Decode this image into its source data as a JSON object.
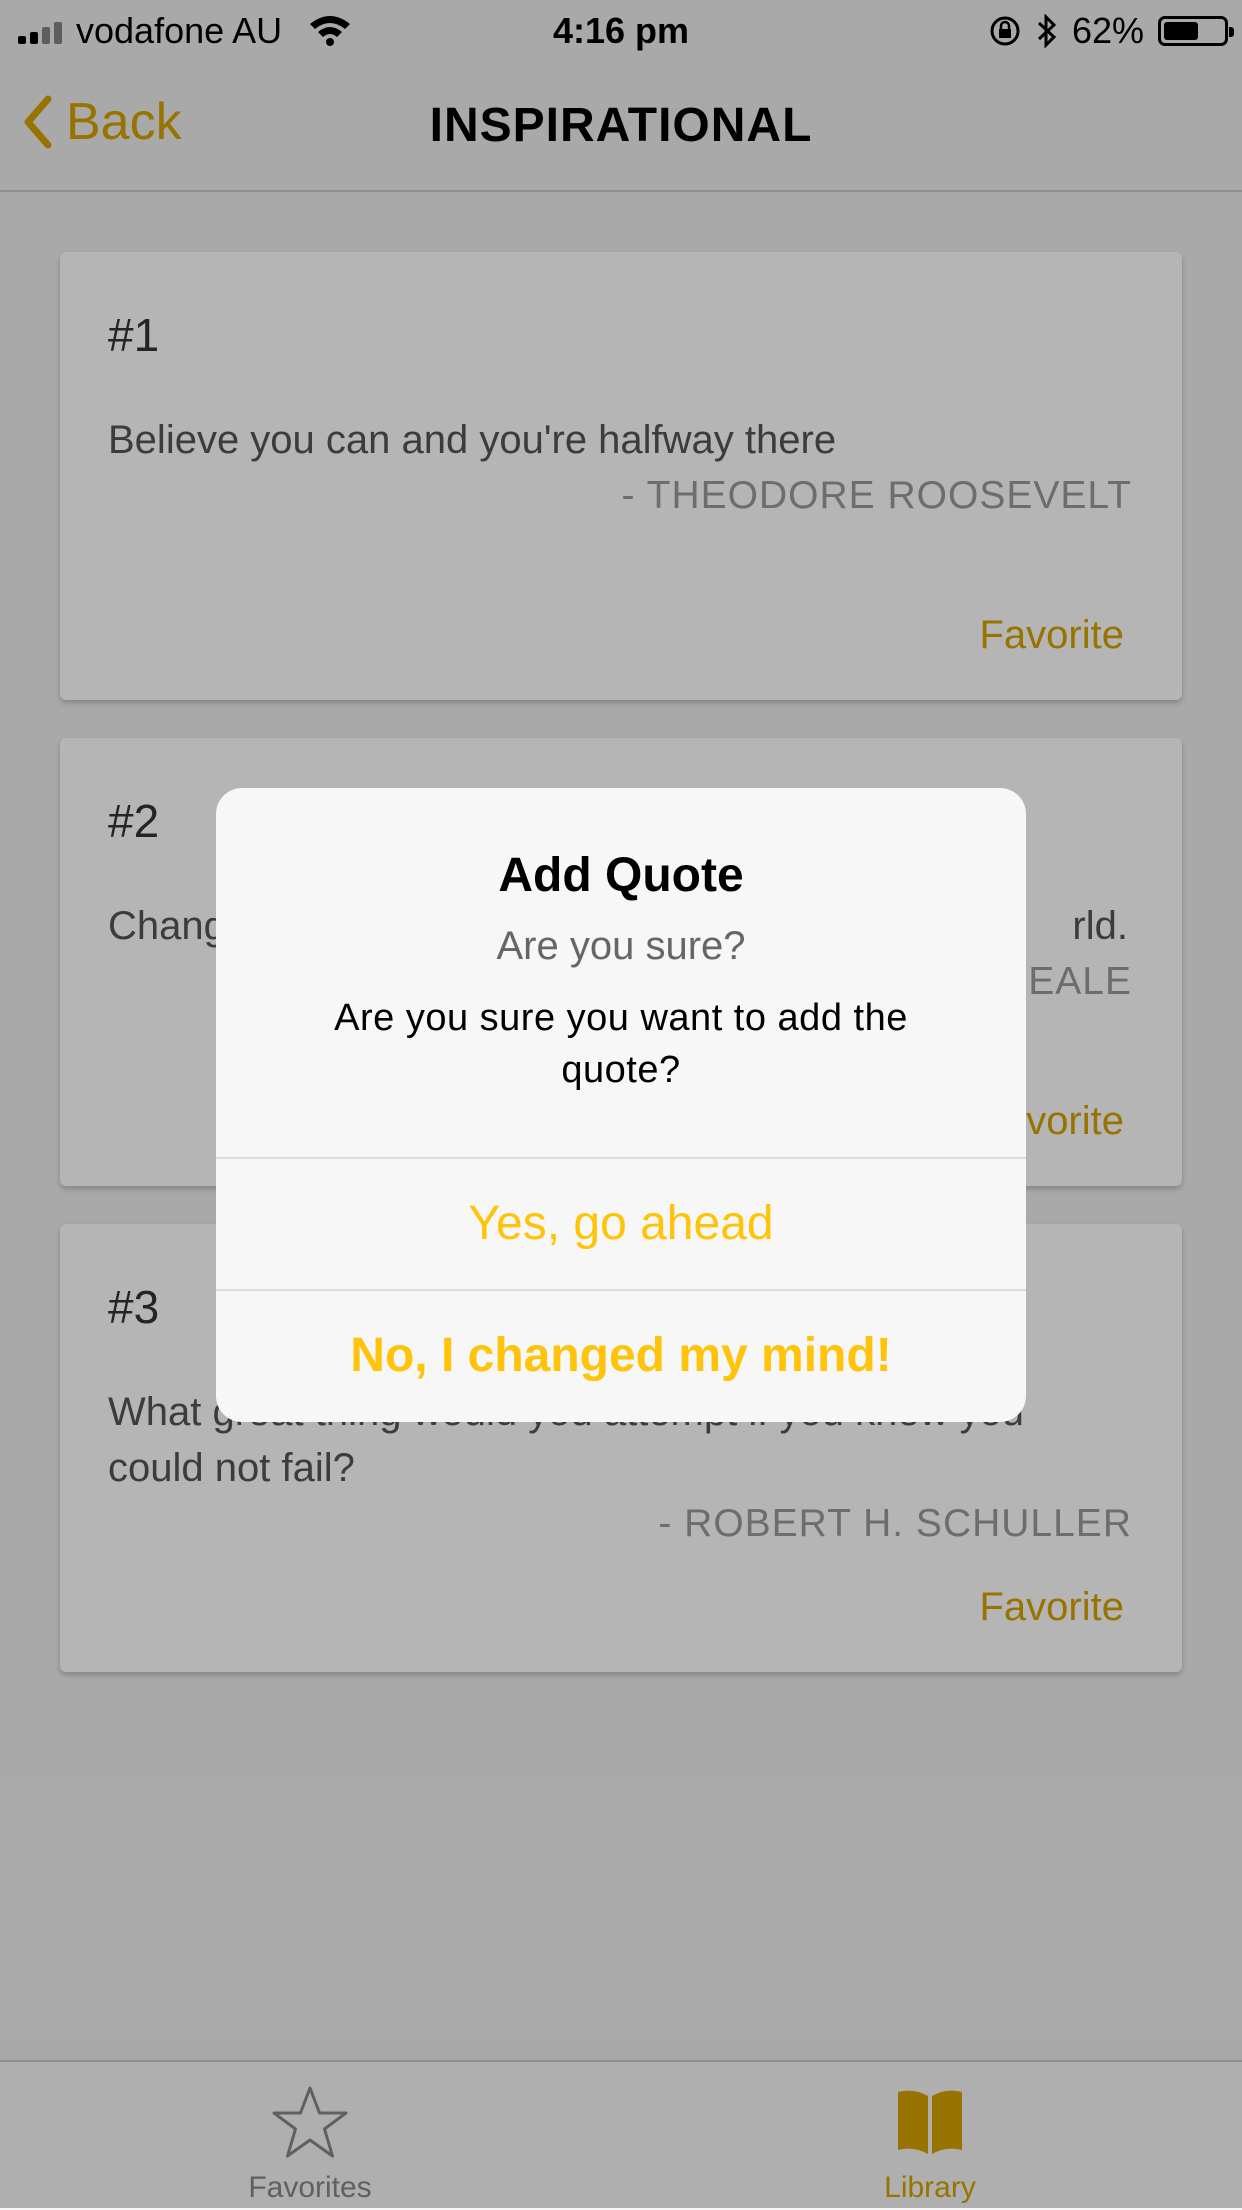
{
  "status_bar": {
    "carrier": "vodafone AU",
    "time": "4:16 pm",
    "battery_percent": "62%",
    "battery_level": 0.62,
    "icons": [
      "signal-icon",
      "wifi-icon",
      "orientation-lock-icon",
      "bluetooth-icon",
      "battery-icon"
    ]
  },
  "nav": {
    "back_label": "Back",
    "title": "INSPIRATIONAL"
  },
  "cards": [
    {
      "number": "#1",
      "quote": "Believe you can and you're halfway there",
      "author": "- THEODORE ROOSEVELT",
      "favorite_label": "Favorite"
    },
    {
      "number": "#2",
      "quote_visible_left": "Chang",
      "quote_visible_right": "rld.",
      "author_visible": "PEALE",
      "favorite_label": "Favorite",
      "favorite_visible": "vorite"
    },
    {
      "number": "#3",
      "quote": "What great thing would you attempt if you knew you could not fail?",
      "author": "- ROBERT H. SCHULLER",
      "favorite_label": "Favorite"
    }
  ],
  "alert": {
    "title": "Add Quote",
    "subtitle": "Are you sure?",
    "message": "Are you sure you want to add the quote?",
    "confirm_label": "Yes, go ahead",
    "cancel_label": "No, I changed my mind!"
  },
  "tabs": [
    {
      "label": "Favorites",
      "icon": "star-icon",
      "active": false
    },
    {
      "label": "Library",
      "icon": "book-icon",
      "active": true
    }
  ],
  "colors": {
    "accent": "#d6a300",
    "alert_button": "#ffc30a",
    "background": "#efefef",
    "overlay": "rgba(0,0,0,0.29)"
  }
}
